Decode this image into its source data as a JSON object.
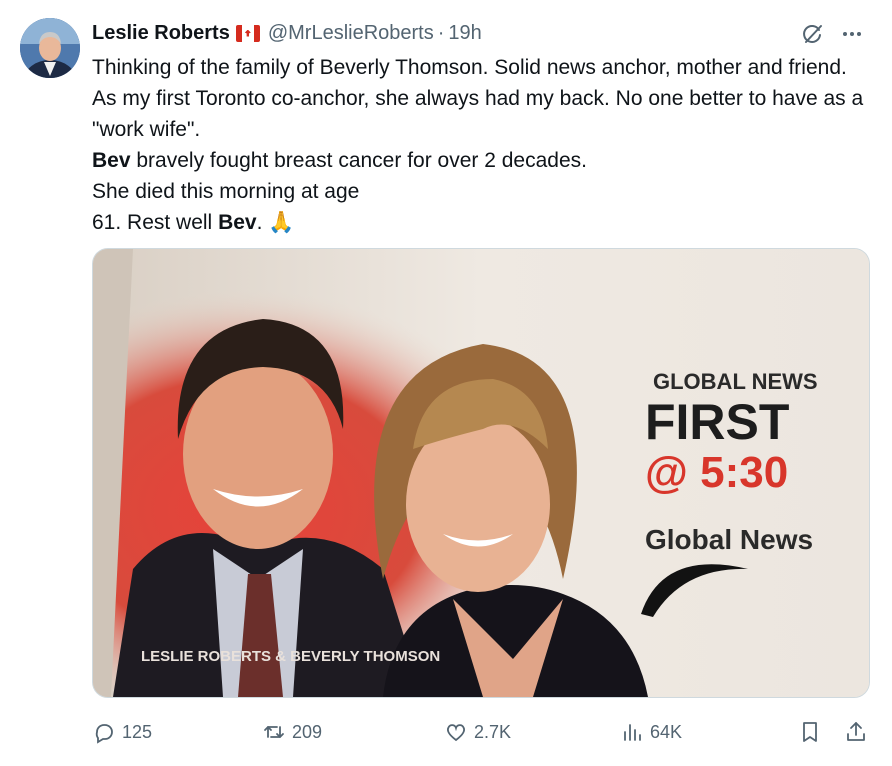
{
  "tweet": {
    "author_name": "Leslie Roberts",
    "handle": "@MrLeslieRoberts",
    "separator": "·",
    "time": "19h",
    "lines": [
      "Thinking of the family of Beverly Thomson. Solid news anchor, mother and friend. As my first Toronto co-anchor, she always had my back. No one better to have as a \"work wife\".",
      "bravely fought breast cancer for over 2 decades.",
      "She died this morning at age",
      "61. Rest well"
    ],
    "bold_name": "Bev",
    "period": ".",
    "emoji": "🙏"
  },
  "media": {
    "headline_small": "GLOBAL NEWS",
    "headline_big": "FIRST",
    "headline_time": "@ 5:30",
    "brand": "Global News",
    "caption": "LESLIE ROBERTS & BEVERLY THOMSON"
  },
  "actions": {
    "replies": "125",
    "reposts": "209",
    "likes": "2.7K",
    "views": "64K"
  },
  "colors": {
    "text": "#0f1419",
    "secondary": "#536471",
    "flag_red": "#d52b1e"
  }
}
